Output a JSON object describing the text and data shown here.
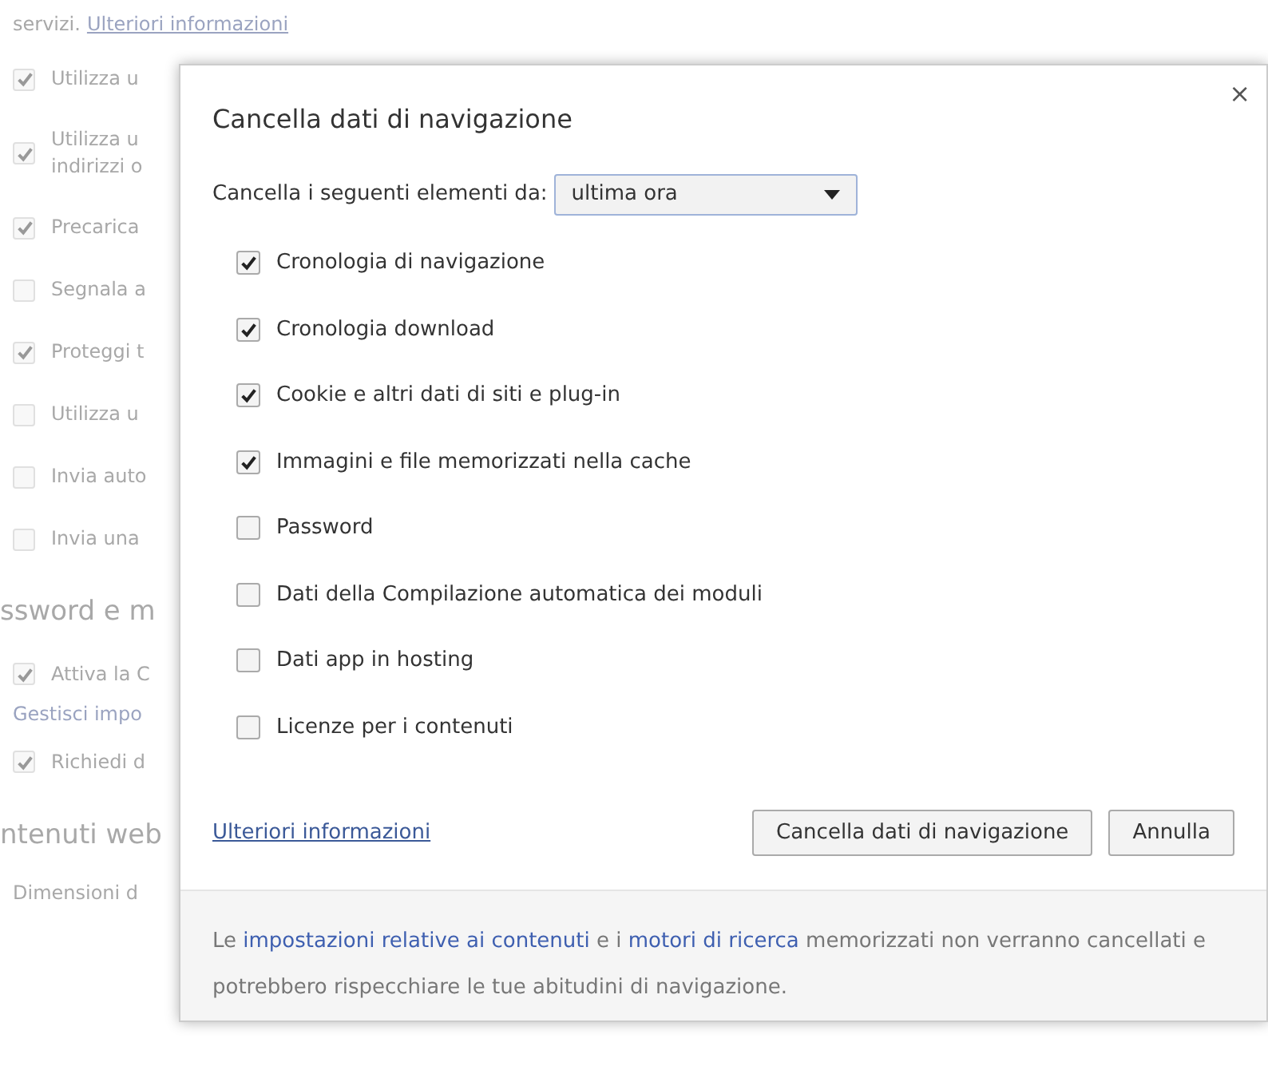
{
  "background": {
    "items": [
      {
        "kind": "intro",
        "text": "servizi.",
        "link": "Ulteriori informazioni"
      },
      {
        "kind": "checkbox",
        "checked": true,
        "lines": [
          "Utilizza u"
        ]
      },
      {
        "kind": "checkbox",
        "checked": true,
        "lines": [
          "Utilizza u",
          "indirizzi o"
        ]
      },
      {
        "kind": "checkbox",
        "checked": true,
        "lines": [
          "Precarica"
        ]
      },
      {
        "kind": "checkbox",
        "checked": false,
        "lines": [
          "Segnala a"
        ]
      },
      {
        "kind": "checkbox",
        "checked": true,
        "lines": [
          "Proteggi t"
        ]
      },
      {
        "kind": "checkbox",
        "checked": false,
        "lines": [
          "Utilizza u"
        ]
      },
      {
        "kind": "checkbox",
        "checked": false,
        "lines": [
          "Invia auto"
        ]
      },
      {
        "kind": "checkbox",
        "checked": false,
        "lines": [
          "Invia una"
        ]
      },
      {
        "kind": "heading",
        "text": "ssword e m"
      },
      {
        "kind": "checkbox",
        "checked": true,
        "lines": [
          "Attiva la C"
        ]
      },
      {
        "kind": "link",
        "text": "Gestisci impo"
      },
      {
        "kind": "checkbox",
        "checked": true,
        "lines": [
          "Richiedi d"
        ]
      },
      {
        "kind": "heading",
        "text": "ntenuti web"
      },
      {
        "kind": "text",
        "text": "Dimensioni d"
      }
    ]
  },
  "dialog": {
    "title": "Cancella dati di navigazione",
    "close": "×",
    "range": {
      "label": "Cancella i seguenti elementi da:",
      "value": "ultima ora"
    },
    "options": [
      {
        "label": "Cronologia di navigazione",
        "checked": true
      },
      {
        "label": "Cronologia download",
        "checked": true
      },
      {
        "label": "Cookie e altri dati di siti e plug-in",
        "checked": true
      },
      {
        "label": "Immagini e file memorizzati nella cache",
        "checked": true
      },
      {
        "label": "Password",
        "checked": false
      },
      {
        "label": "Dati della Compilazione automatica dei moduli",
        "checked": false
      },
      {
        "label": "Dati app in hosting",
        "checked": false
      },
      {
        "label": "Licenze per i contenuti",
        "checked": false
      }
    ],
    "more_link": "Ulteriori informazioni",
    "buttons": [
      "Cancella dati di navigazione",
      "Annulla"
    ],
    "note": [
      {
        "text": "Le ",
        "link": false
      },
      {
        "text": "impostazioni relative ai contenuti",
        "link": true
      },
      {
        "text": " e i ",
        "link": false
      },
      {
        "text": "motori di ricerca",
        "link": true
      },
      {
        "text": " memorizzati non verranno cancellati e potrebbero rispecchiare le tue abitudini di navigazione.",
        "link": false
      }
    ]
  }
}
